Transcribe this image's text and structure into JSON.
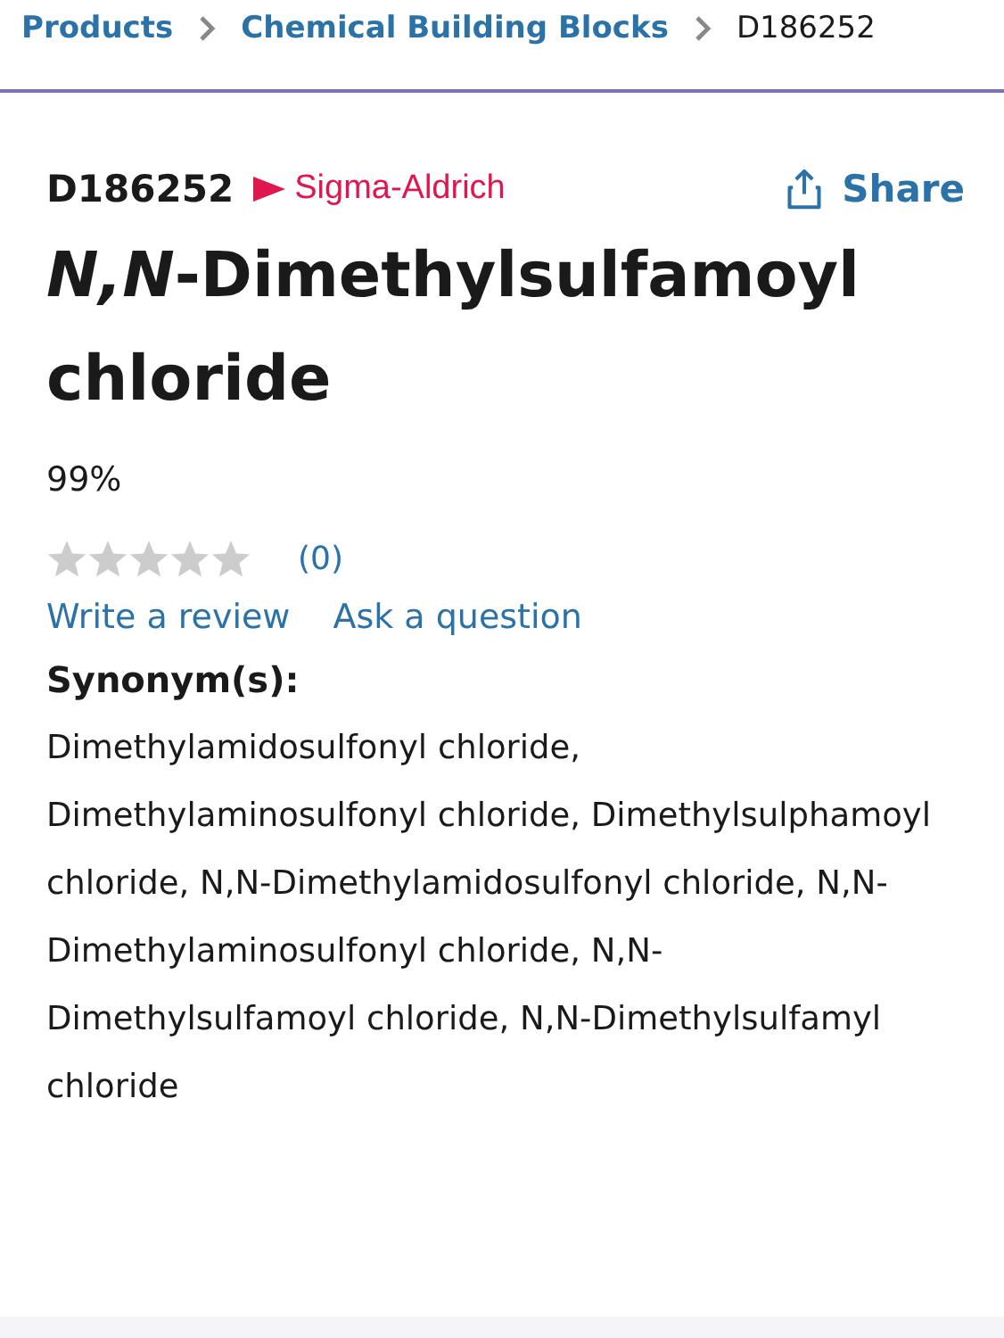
{
  "breadcrumbs": [
    {
      "label": "Products",
      "link": true
    },
    {
      "label": "Chemical Building Blocks",
      "link": true
    },
    {
      "label": "D186252",
      "link": false
    }
  ],
  "product": {
    "number": "D186252",
    "brand": "Sigma-Aldrich",
    "share": "Share",
    "title": "*N,N*-Dimethylsulfamoyl chloride",
    "purity": "99%"
  },
  "rating": {
    "stars": 0,
    "count": "(0)"
  },
  "links": [
    "Write a review",
    "Ask a question"
  ],
  "synonyms": {
    "heading": "Synonym(s):",
    "text": "Dimethylamidosulfonyl chloride, Dimethylaminosulfonyl chloride, Dimethylsulphamoyl chloride, N,N-Dimethylamidosulfonyl chloride, N,N-Dimethylaminosulfonyl chloride, N,N-Dimethylsulfamoyl chloride, N,N-Dimethylsulfamyl chloride"
  }
}
